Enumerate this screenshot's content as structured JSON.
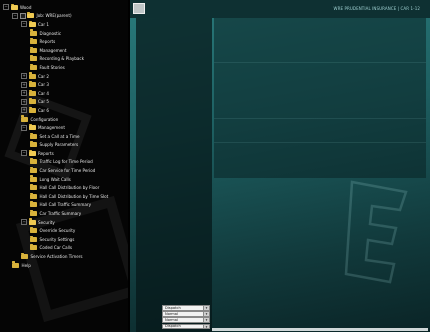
{
  "tree": {
    "items": [
      {
        "label": "Wood",
        "depth": 0,
        "expander": "−",
        "checkbox": false,
        "open": true
      },
      {
        "label": "Job: WRE(parent)",
        "depth": 1,
        "expander": "−",
        "checkbox": true,
        "open": true
      },
      {
        "label": "Car 1",
        "depth": 2,
        "expander": "−",
        "checkbox": false,
        "open": true
      },
      {
        "label": "Diagnostic",
        "depth": 3,
        "expander": "",
        "checkbox": false,
        "open": false
      },
      {
        "label": "Reports",
        "depth": 3,
        "expander": "",
        "checkbox": false,
        "open": false
      },
      {
        "label": "Management",
        "depth": 3,
        "expander": "",
        "checkbox": false,
        "open": false
      },
      {
        "label": "Recording & Playback",
        "depth": 3,
        "expander": "",
        "checkbox": false,
        "open": false
      },
      {
        "label": "Fault Stories",
        "depth": 3,
        "expander": "",
        "checkbox": false,
        "open": false
      },
      {
        "label": "Car 2",
        "depth": 2,
        "expander": "+",
        "checkbox": false,
        "open": false
      },
      {
        "label": "Car 3",
        "depth": 2,
        "expander": "+",
        "checkbox": false,
        "open": false
      },
      {
        "label": "Car 4",
        "depth": 2,
        "expander": "+",
        "checkbox": false,
        "open": false
      },
      {
        "label": "Car 5",
        "depth": 2,
        "expander": "+",
        "checkbox": false,
        "open": false
      },
      {
        "label": "Car 6",
        "depth": 2,
        "expander": "+",
        "checkbox": false,
        "open": false
      },
      {
        "label": "Configuration",
        "depth": 2,
        "expander": "",
        "checkbox": false,
        "open": false
      },
      {
        "label": "Management",
        "depth": 2,
        "expander": "−",
        "checkbox": false,
        "open": true
      },
      {
        "label": "Set a Call at a Time",
        "depth": 3,
        "expander": "",
        "checkbox": false,
        "open": false
      },
      {
        "label": "Supply Parameters",
        "depth": 3,
        "expander": "",
        "checkbox": false,
        "open": false
      },
      {
        "label": "Reports",
        "depth": 2,
        "expander": "−",
        "checkbox": false,
        "open": true
      },
      {
        "label": "Traffic Log for Time Period",
        "depth": 3,
        "expander": "",
        "checkbox": false,
        "open": false
      },
      {
        "label": "Car Service for Time Period",
        "depth": 3,
        "expander": "",
        "checkbox": false,
        "open": false
      },
      {
        "label": "Long Wait Calls",
        "depth": 3,
        "expander": "",
        "checkbox": false,
        "open": false
      },
      {
        "label": "Hall Call Distribution by Floor",
        "depth": 3,
        "expander": "",
        "checkbox": false,
        "open": false
      },
      {
        "label": "Hall Call Distribution by Time Slot",
        "depth": 3,
        "expander": "",
        "checkbox": false,
        "open": false
      },
      {
        "label": "Hall Call Traffic Summary",
        "depth": 3,
        "expander": "",
        "checkbox": false,
        "open": false
      },
      {
        "label": "Car Traffic Summary",
        "depth": 3,
        "expander": "",
        "checkbox": false,
        "open": false
      },
      {
        "label": "Security",
        "depth": 2,
        "expander": "−",
        "checkbox": false,
        "open": true
      },
      {
        "label": "Override Security",
        "depth": 3,
        "expander": "",
        "checkbox": false,
        "open": false
      },
      {
        "label": "Security Settings",
        "depth": 3,
        "expander": "",
        "checkbox": false,
        "open": false
      },
      {
        "label": "Coded Car Calls",
        "depth": 3,
        "expander": "",
        "checkbox": false,
        "open": false
      },
      {
        "label": "Service Activation Timers",
        "depth": 2,
        "expander": "",
        "checkbox": false,
        "open": false
      },
      {
        "label": "Help",
        "depth": 1,
        "expander": "",
        "checkbox": false,
        "open": false
      }
    ]
  },
  "header": {
    "title": "WRE PRUDENTIAL INSURANCE | CAR 1-12"
  },
  "status": {
    "rows": [
      {
        "label": "Zone",
        "value": "Dispatch"
      },
      {
        "label": "Mode",
        "value": "Normal"
      },
      {
        "label": "Traffic",
        "value": "Normal"
      },
      {
        "label": "Group",
        "value": "Dispatch"
      }
    ]
  },
  "colors": {
    "folder": "#d8b23b",
    "teal_top": "#297a7b",
    "teal_bottom": "#0a2426"
  }
}
